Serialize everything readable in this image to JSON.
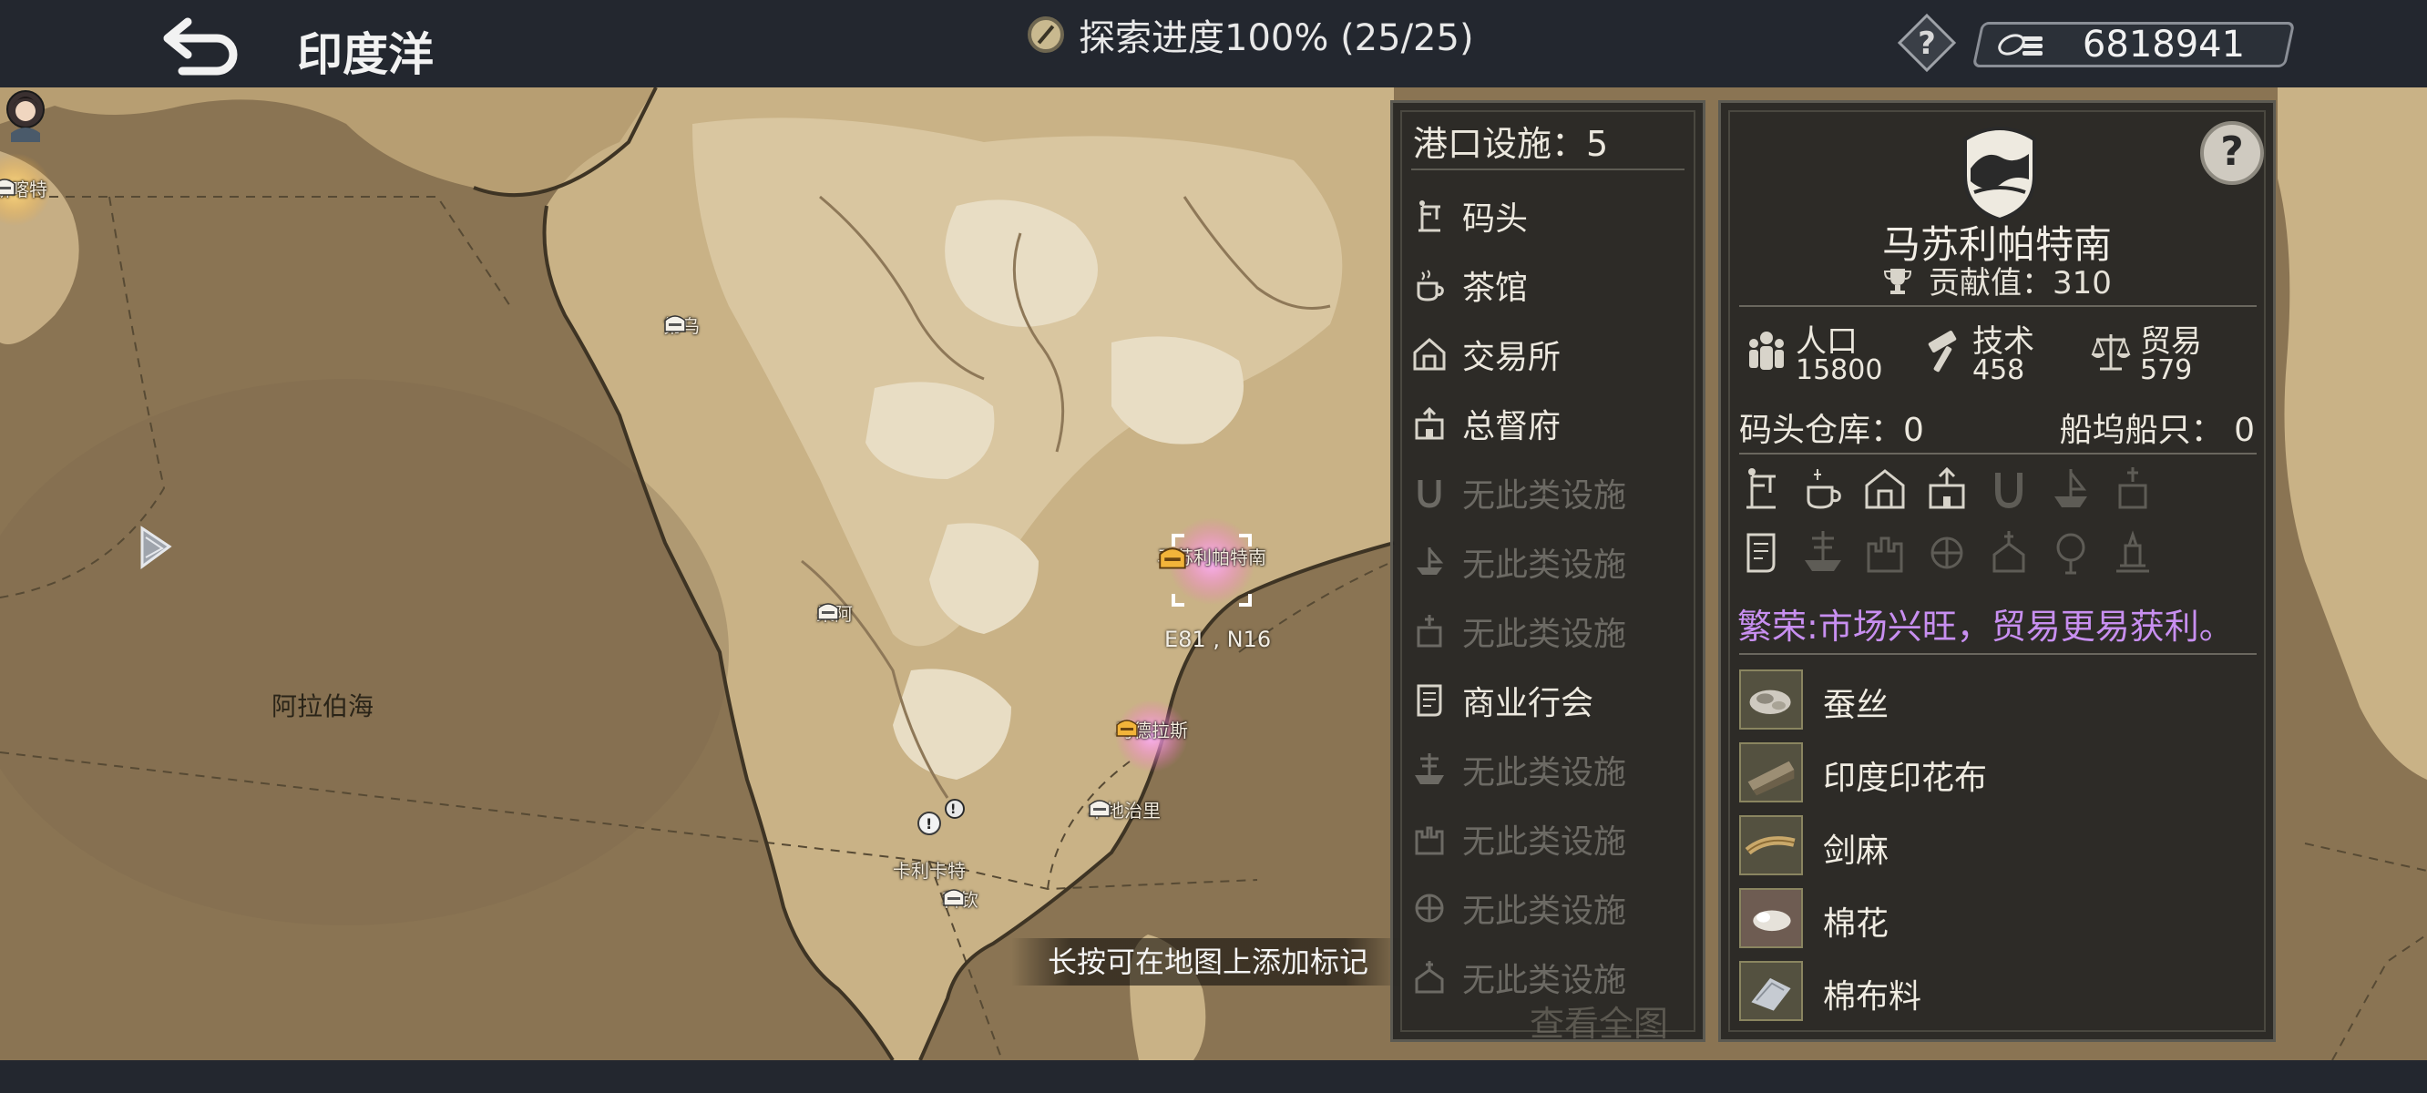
{
  "header": {
    "title": "印度洋",
    "exploration": "探索进度100% (25/25)",
    "currency_value": "6818941",
    "help_icon": "question-icon",
    "back_icon": "back-arrow-icon"
  },
  "map": {
    "cities": [
      {
        "name": "斯喀特",
        "active": false,
        "highlight": true
      },
      {
        "name": "第乌",
        "active": false
      },
      {
        "name": "果阿",
        "active": false
      },
      {
        "name": "马苏利帕特南",
        "active": true
      },
      {
        "name": "马德拉斯",
        "active": false,
        "highlight": true
      },
      {
        "name": "本地治里",
        "active": false
      },
      {
        "name": "卡利卡特",
        "active": false
      },
      {
        "name": "科钦",
        "active": false
      }
    ],
    "sea_label": "阿拉伯海",
    "coords": "E81 , N16",
    "hint": "长按可在地图上添加标记"
  },
  "facilities": {
    "title": "港口设施：5",
    "items": [
      {
        "label": "码头",
        "icon": "dock-icon",
        "available": true
      },
      {
        "label": "茶馆",
        "icon": "teahouse-icon",
        "available": true
      },
      {
        "label": "交易所",
        "icon": "exchange-icon",
        "available": true
      },
      {
        "label": "总督府",
        "icon": "governor-icon",
        "available": true
      },
      {
        "label": "无此类设施",
        "icon": "horseshoe-icon",
        "available": false
      },
      {
        "label": "无此类设施",
        "icon": "shipyard-icon",
        "available": false
      },
      {
        "label": "无此类设施",
        "icon": "church-icon",
        "available": false
      },
      {
        "label": "商业行会",
        "icon": "guild-icon",
        "available": true
      },
      {
        "label": "无此类设施",
        "icon": "ship-icon",
        "available": false
      },
      {
        "label": "无此类设施",
        "icon": "castle-icon",
        "available": false
      },
      {
        "label": "无此类设施",
        "icon": "temple-icon",
        "available": false
      },
      {
        "label": "无此类设施",
        "icon": "chapel-icon",
        "available": false
      }
    ],
    "view_all": "查看全图"
  },
  "city": {
    "name": "马苏利帕特南",
    "contribution": "贡献值：310",
    "stats": [
      {
        "label": "人口",
        "value": "15800",
        "icon": "population-icon"
      },
      {
        "label": "技术",
        "value": "458",
        "icon": "hammer-icon"
      },
      {
        "label": "贸易",
        "value": "579",
        "icon": "scales-icon"
      }
    ],
    "dock_storage": "码头仓库：0",
    "shipyard_ships": "船坞船只：  0",
    "prosperity": "繁荣:市场兴旺，贸易更易获利。",
    "goods": [
      {
        "name": "蚕丝",
        "icon": "silk-icon"
      },
      {
        "name": "印度印花布",
        "icon": "chintz-icon"
      },
      {
        "name": "剑麻",
        "icon": "sisal-icon"
      },
      {
        "name": "棉花",
        "icon": "cotton-icon"
      },
      {
        "name": "棉布料",
        "icon": "cotton-cloth-icon"
      }
    ]
  }
}
